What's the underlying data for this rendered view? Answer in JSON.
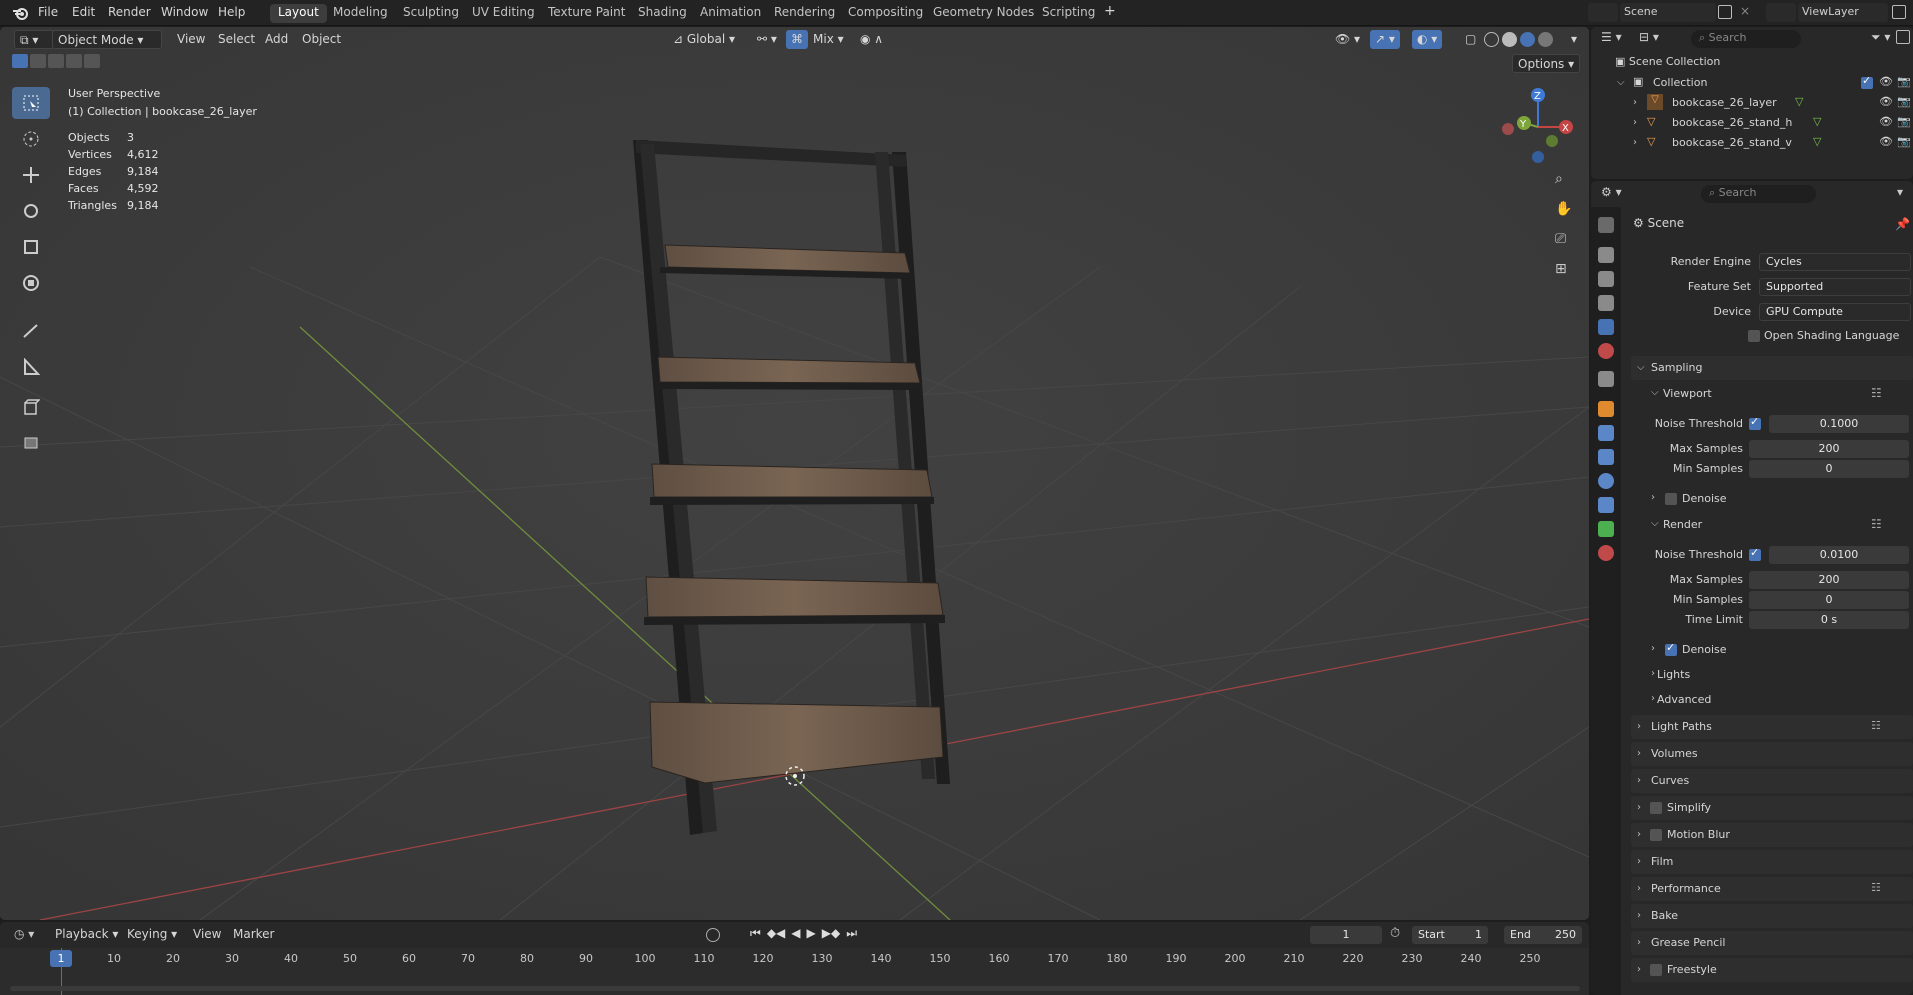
{
  "menu": [
    "File",
    "Edit",
    "Render",
    "Window",
    "Help"
  ],
  "workspaces": [
    "Layout",
    "Modeling",
    "Sculpting",
    "UV Editing",
    "Texture Paint",
    "Shading",
    "Animation",
    "Rendering",
    "Compositing",
    "Geometry Nodes",
    "Scripting"
  ],
  "add_tab": "+",
  "scene_name": "Scene",
  "view_layer": "ViewLayer",
  "viewport": {
    "mode": "Object Mode",
    "menus": [
      "View",
      "Select",
      "Add",
      "Object"
    ],
    "orientation": "Global",
    "snap_mix": "Mix",
    "options": "Options",
    "perspective": "User Perspective",
    "context": "(1) Collection | bookcase_26_layer",
    "stats": [
      [
        "Objects",
        "3"
      ],
      [
        "Vertices",
        "4,612"
      ],
      [
        "Edges",
        "9,184"
      ],
      [
        "Faces",
        "4,592"
      ],
      [
        "Triangles",
        "9,184"
      ]
    ],
    "gizmo": {
      "x": "X",
      "y": "Y",
      "z": "Z"
    }
  },
  "outliner": {
    "search": "Search",
    "root": "Scene Collection",
    "collection": "Collection",
    "objects": [
      "bookcase_26_layer",
      "bookcase_26_stand_h",
      "bookcase_26_stand_v"
    ]
  },
  "properties": {
    "search": "Search",
    "context": "Scene",
    "render_engine_label": "Render Engine",
    "render_engine": "Cycles",
    "feature_set_label": "Feature Set",
    "feature_set": "Supported",
    "device_label": "Device",
    "device": "GPU Compute",
    "osl": "Open Shading Language",
    "sampling": "Sampling",
    "viewport": "Viewport",
    "noise_threshold": "Noise Threshold",
    "max_samples": "Max Samples",
    "min_samples": "Min Samples",
    "vp_noise": "0.1000",
    "vp_max": "200",
    "vp_min": "0",
    "denoise": "Denoise",
    "render": "Render",
    "r_noise": "0.0100",
    "r_max": "200",
    "r_min": "0",
    "time_limit": "Time Limit",
    "r_time": "0 s",
    "sub_panels": [
      "Lights",
      "Advanced"
    ],
    "panels": [
      "Light Paths",
      "Volumes",
      "Curves",
      "Simplify",
      "Motion Blur",
      "Film",
      "Performance",
      "Bake",
      "Grease Pencil",
      "Freestyle"
    ]
  },
  "timeline": {
    "menus": [
      "Playback",
      "Keying",
      "View",
      "Marker"
    ],
    "current": "1",
    "start_label": "Start",
    "start": "1",
    "end_label": "End",
    "end": "250",
    "frame_marker": "1",
    "ticks": [
      "10",
      "20",
      "30",
      "40",
      "50",
      "60",
      "70",
      "80",
      "90",
      "100",
      "110",
      "120",
      "130",
      "140",
      "150",
      "160",
      "170",
      "180",
      "190",
      "200",
      "210",
      "220",
      "230",
      "240",
      "250"
    ]
  },
  "colors": {
    "accent": "#4772b3",
    "x_axis": "#c54545",
    "y_axis": "#7da53a",
    "z_axis": "#3f7bd6",
    "frame": "#1e1e1e",
    "wood": "#6e5a48"
  }
}
